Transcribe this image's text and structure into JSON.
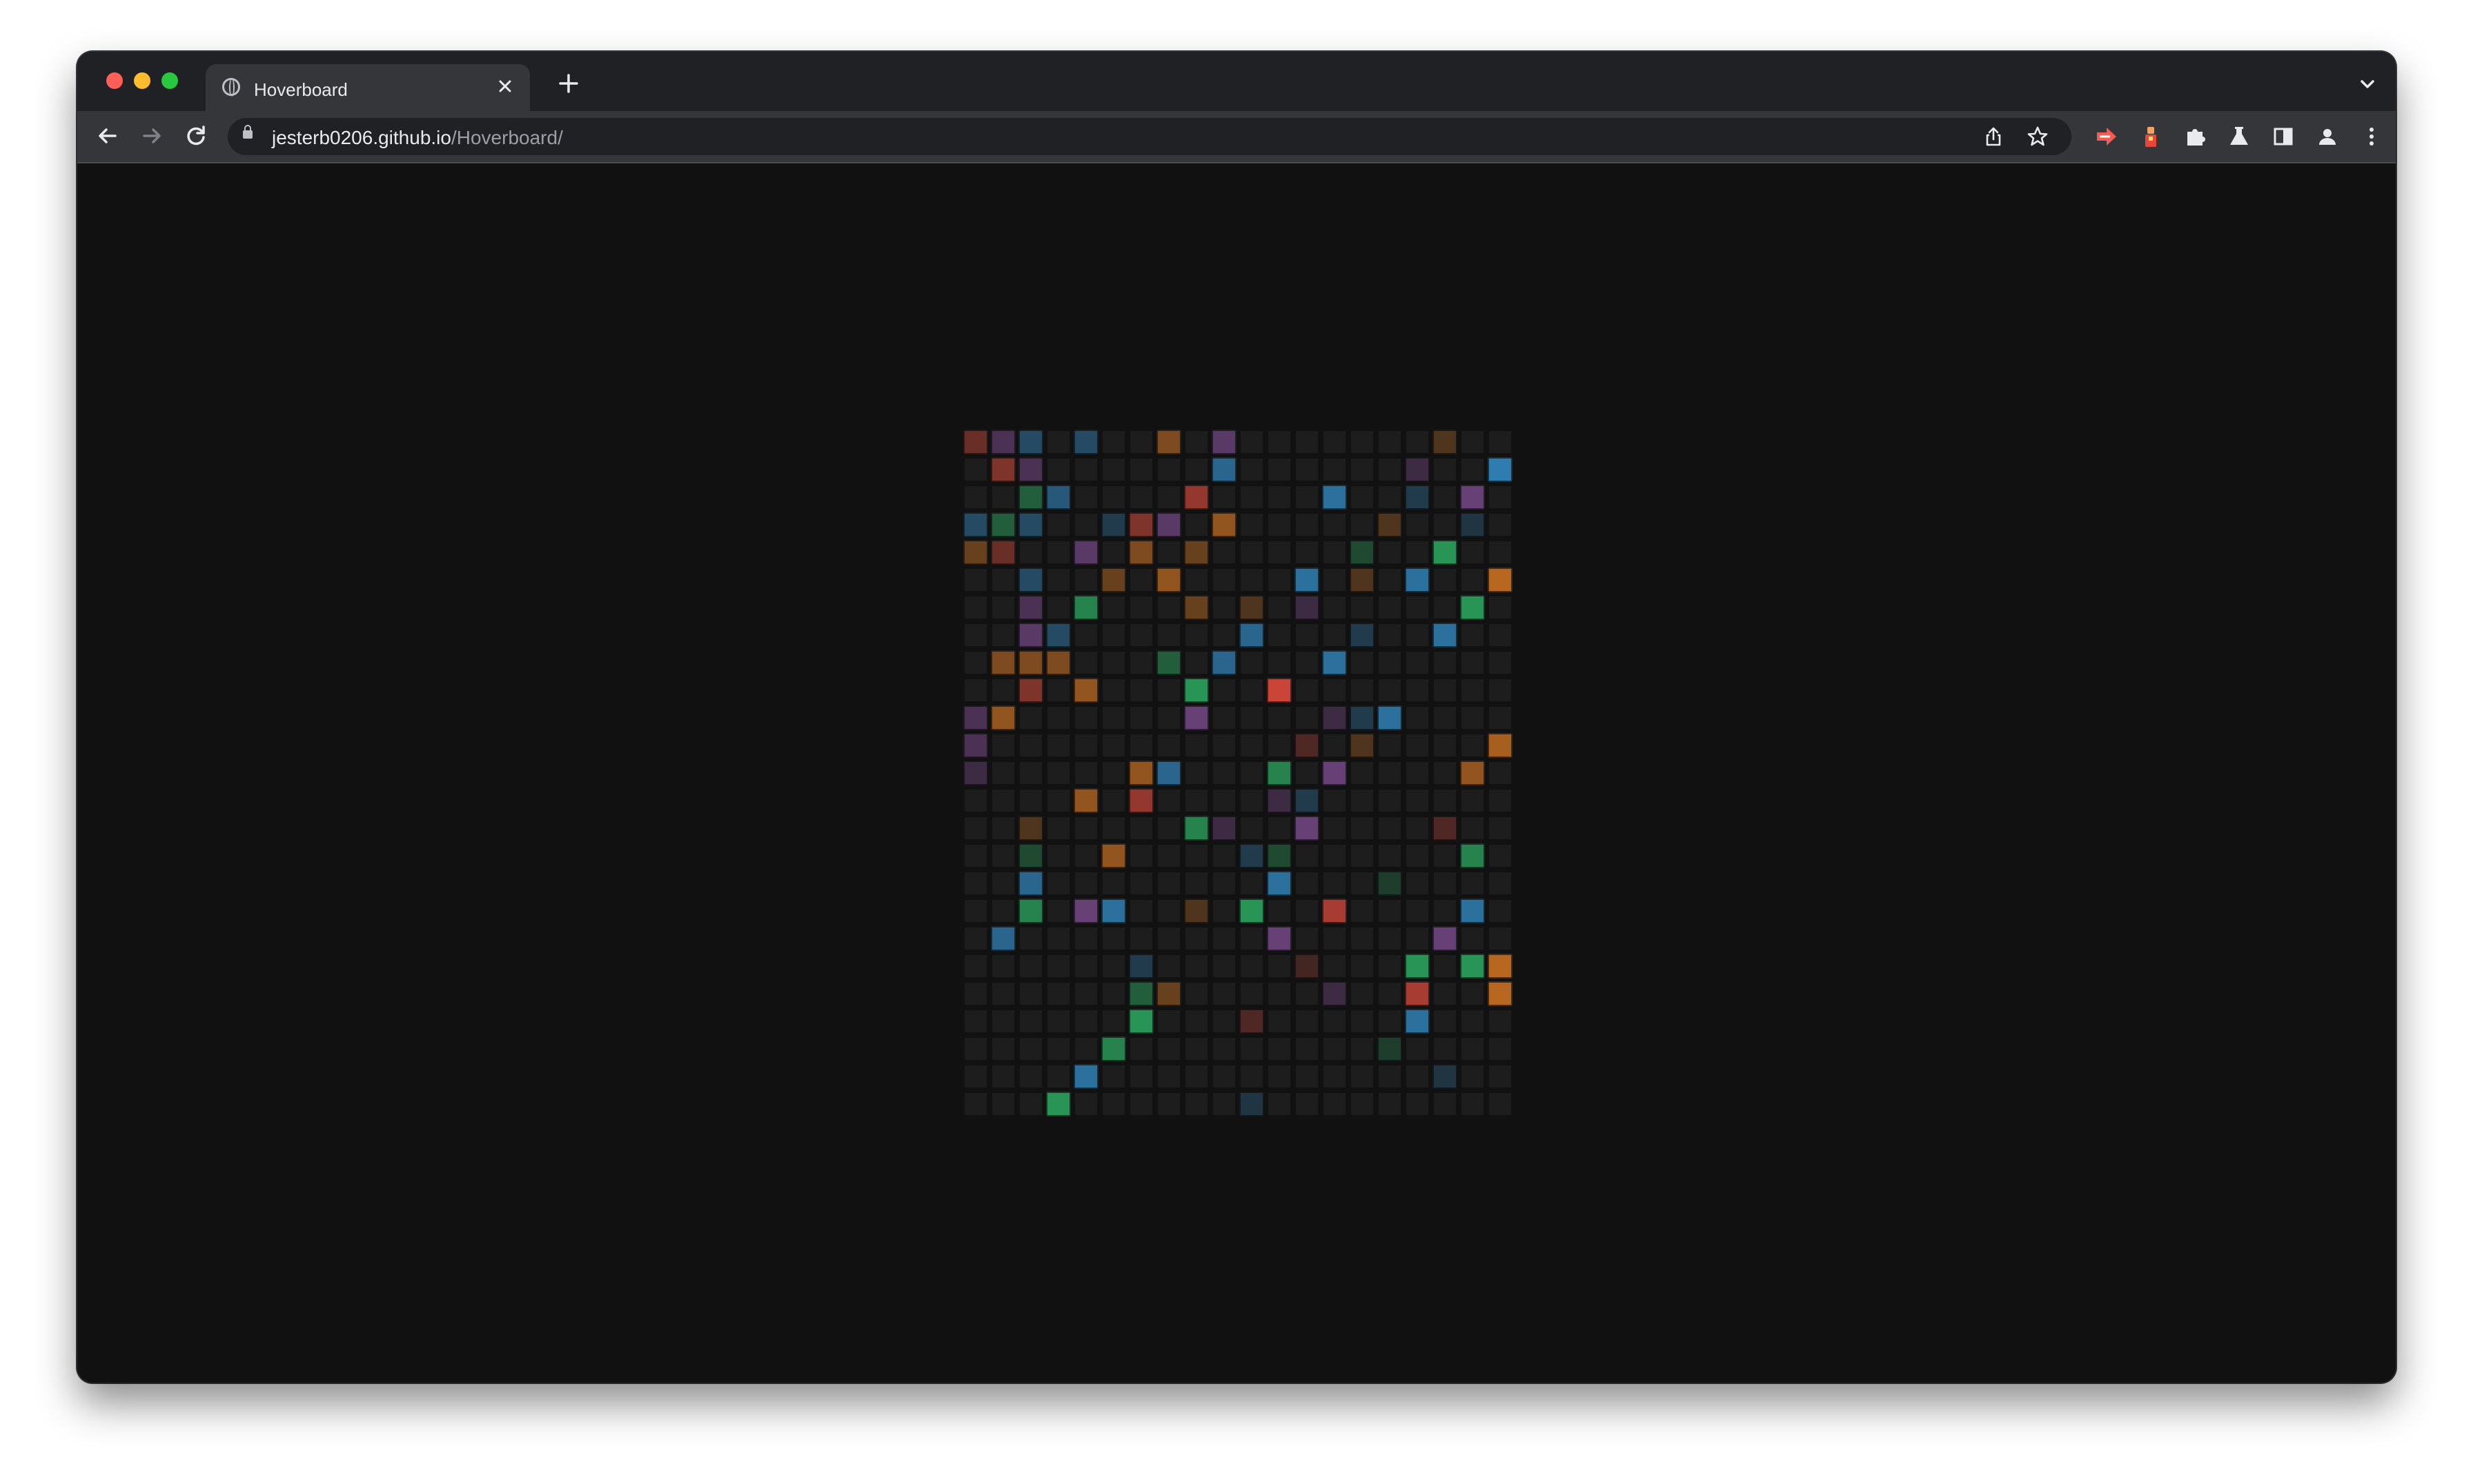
{
  "tab": {
    "title": "Hoverboard"
  },
  "address": {
    "host": "jesterb0206.github.io",
    "path": "/Hoverboard/"
  },
  "icons": {
    "tab_favicon": "globe-icon",
    "close": "close-icon",
    "new_tab": "plus-icon",
    "back": "arrow-left-icon",
    "forward": "arrow-right-icon",
    "reload": "reload-icon",
    "lock": "lock-icon",
    "share": "share-icon",
    "bookmark": "star-icon",
    "extensions": "puzzle-icon",
    "labs": "flask-icon",
    "side_panel": "side-panel-icon",
    "profile": "person-icon",
    "menu": "kebab-menu-icon"
  },
  "board": {
    "rows": 25,
    "cols": 20,
    "base_color": "#1d1d1d",
    "palette": {
      "r": "#e74c3c",
      "o": "#e67e22",
      "g": "#2ecc71",
      "b": "#3498db",
      "p": "#9b59b6"
    },
    "lit": [
      [
        0,
        0,
        "r",
        0.3
      ],
      [
        0,
        1,
        "p",
        0.3
      ],
      [
        0,
        2,
        "b",
        0.3
      ],
      [
        0,
        4,
        "b",
        0.3
      ],
      [
        0,
        7,
        "o",
        0.4
      ],
      [
        0,
        9,
        "p",
        0.4
      ],
      [
        0,
        17,
        "o",
        0.2
      ],
      [
        1,
        1,
        "r",
        0.4
      ],
      [
        1,
        2,
        "p",
        0.3
      ],
      [
        1,
        9,
        "b",
        0.5
      ],
      [
        1,
        16,
        "p",
        0.2
      ],
      [
        1,
        19,
        "b",
        0.7
      ],
      [
        2,
        2,
        "g",
        0.3
      ],
      [
        2,
        3,
        "b",
        0.4
      ],
      [
        2,
        8,
        "r",
        0.5
      ],
      [
        2,
        13,
        "b",
        0.6
      ],
      [
        2,
        16,
        "b",
        0.2
      ],
      [
        2,
        18,
        "p",
        0.5
      ],
      [
        3,
        0,
        "b",
        0.3
      ],
      [
        3,
        1,
        "g",
        0.3
      ],
      [
        3,
        2,
        "b",
        0.3
      ],
      [
        3,
        5,
        "b",
        0.2
      ],
      [
        3,
        6,
        "r",
        0.4
      ],
      [
        3,
        7,
        "p",
        0.4
      ],
      [
        3,
        9,
        "o",
        0.5
      ],
      [
        3,
        15,
        "o",
        0.2
      ],
      [
        3,
        18,
        "b",
        0.15
      ],
      [
        4,
        0,
        "o",
        0.3
      ],
      [
        4,
        1,
        "r",
        0.3
      ],
      [
        4,
        4,
        "p",
        0.4
      ],
      [
        4,
        6,
        "o",
        0.4
      ],
      [
        4,
        8,
        "o",
        0.3
      ],
      [
        4,
        14,
        "g",
        0.2
      ],
      [
        4,
        17,
        "g",
        0.6
      ],
      [
        5,
        2,
        "b",
        0.3
      ],
      [
        5,
        5,
        "o",
        0.3
      ],
      [
        5,
        7,
        "o",
        0.5
      ],
      [
        5,
        12,
        "b",
        0.6
      ],
      [
        5,
        14,
        "o",
        0.2
      ],
      [
        5,
        16,
        "b",
        0.6
      ],
      [
        5,
        19,
        "o",
        0.7
      ],
      [
        6,
        2,
        "p",
        0.3
      ],
      [
        6,
        4,
        "g",
        0.5
      ],
      [
        6,
        8,
        "o",
        0.3
      ],
      [
        6,
        10,
        "o",
        0.2
      ],
      [
        6,
        12,
        "p",
        0.2
      ],
      [
        6,
        18,
        "g",
        0.6
      ],
      [
        7,
        2,
        "p",
        0.4
      ],
      [
        7,
        3,
        "b",
        0.3
      ],
      [
        7,
        10,
        "b",
        0.5
      ],
      [
        7,
        14,
        "b",
        0.2
      ],
      [
        7,
        17,
        "b",
        0.6
      ],
      [
        8,
        1,
        "o",
        0.4
      ],
      [
        8,
        2,
        "o",
        0.4
      ],
      [
        8,
        3,
        "o",
        0.4
      ],
      [
        8,
        7,
        "g",
        0.3
      ],
      [
        8,
        9,
        "b",
        0.5
      ],
      [
        8,
        13,
        "b",
        0.6
      ],
      [
        9,
        2,
        "r",
        0.4
      ],
      [
        9,
        4,
        "o",
        0.5
      ],
      [
        9,
        8,
        "g",
        0.6
      ],
      [
        9,
        11,
        "r",
        0.8
      ],
      [
        10,
        0,
        "p",
        0.3
      ],
      [
        10,
        1,
        "o",
        0.5
      ],
      [
        10,
        8,
        "p",
        0.5
      ],
      [
        10,
        13,
        "p",
        0.2
      ],
      [
        10,
        14,
        "b",
        0.2
      ],
      [
        10,
        15,
        "b",
        0.6
      ],
      [
        11,
        0,
        "p",
        0.3
      ],
      [
        11,
        12,
        "r",
        0.2
      ],
      [
        11,
        14,
        "o",
        0.2
      ],
      [
        11,
        19,
        "o",
        0.6
      ],
      [
        12,
        0,
        "p",
        0.2
      ],
      [
        12,
        6,
        "o",
        0.5
      ],
      [
        12,
        7,
        "b",
        0.5
      ],
      [
        12,
        11,
        "g",
        0.5
      ],
      [
        12,
        13,
        "p",
        0.5
      ],
      [
        12,
        18,
        "o",
        0.5
      ],
      [
        13,
        4,
        "o",
        0.5
      ],
      [
        13,
        6,
        "r",
        0.5
      ],
      [
        13,
        11,
        "p",
        0.2
      ],
      [
        13,
        12,
        "b",
        0.2
      ],
      [
        14,
        2,
        "o",
        0.2
      ],
      [
        14,
        8,
        "g",
        0.5
      ],
      [
        14,
        9,
        "p",
        0.2
      ],
      [
        14,
        12,
        "p",
        0.5
      ],
      [
        14,
        17,
        "r",
        0.2
      ],
      [
        15,
        2,
        "g",
        0.2
      ],
      [
        15,
        5,
        "o",
        0.5
      ],
      [
        15,
        10,
        "b",
        0.2
      ],
      [
        15,
        11,
        "g",
        0.2
      ],
      [
        15,
        18,
        "g",
        0.5
      ],
      [
        16,
        2,
        "b",
        0.5
      ],
      [
        16,
        11,
        "b",
        0.6
      ],
      [
        16,
        15,
        "g",
        0.15
      ],
      [
        17,
        2,
        "g",
        0.5
      ],
      [
        17,
        4,
        "p",
        0.5
      ],
      [
        17,
        5,
        "b",
        0.6
      ],
      [
        17,
        8,
        "o",
        0.2
      ],
      [
        17,
        10,
        "g",
        0.6
      ],
      [
        17,
        13,
        "r",
        0.6
      ],
      [
        17,
        18,
        "b",
        0.6
      ],
      [
        18,
        1,
        "b",
        0.5
      ],
      [
        18,
        11,
        "p",
        0.5
      ],
      [
        18,
        17,
        "p",
        0.5
      ],
      [
        19,
        6,
        "b",
        0.2
      ],
      [
        19,
        12,
        "r",
        0.15
      ],
      [
        19,
        16,
        "g",
        0.6
      ],
      [
        19,
        18,
        "g",
        0.6
      ],
      [
        19,
        19,
        "o",
        0.7
      ],
      [
        20,
        6,
        "g",
        0.3
      ],
      [
        20,
        7,
        "o",
        0.3
      ],
      [
        20,
        13,
        "p",
        0.2
      ],
      [
        20,
        16,
        "r",
        0.6
      ],
      [
        20,
        19,
        "o",
        0.7
      ],
      [
        21,
        6,
        "g",
        0.6
      ],
      [
        21,
        10,
        "r",
        0.2
      ],
      [
        21,
        16,
        "b",
        0.6
      ],
      [
        22,
        5,
        "g",
        0.5
      ],
      [
        22,
        15,
        "g",
        0.15
      ],
      [
        23,
        4,
        "b",
        0.6
      ],
      [
        23,
        17,
        "b",
        0.15
      ],
      [
        24,
        3,
        "g",
        0.6
      ],
      [
        24,
        10,
        "b",
        0.15
      ]
    ]
  }
}
